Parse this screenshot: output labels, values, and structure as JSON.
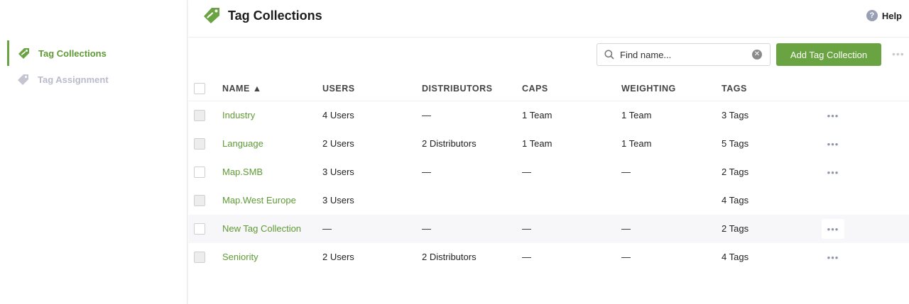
{
  "sidebar": {
    "items": [
      {
        "label": "Tag Collections",
        "icon": "tag-icon",
        "active": true
      },
      {
        "label": "Tag Assignment",
        "icon": "tag-icon",
        "active": false
      }
    ]
  },
  "header": {
    "title": "Tag Collections",
    "help_label": "Help",
    "help_icon": "question-circle-icon"
  },
  "toolbar": {
    "search_placeholder": "Find name...",
    "search_value": "",
    "add_label": "Add Tag Collection",
    "more_label": "•••"
  },
  "colors": {
    "accent": "#6aa342",
    "link": "#5f9a35",
    "muted": "#b9bcc9"
  },
  "table": {
    "columns": [
      "NAME ▲",
      "USERS",
      "DISTRIBUTORS",
      "CAPS",
      "WEIGHTING",
      "TAGS"
    ],
    "sort": {
      "column": "NAME",
      "direction": "asc"
    },
    "more_label": "•••",
    "rows": [
      {
        "name": "Industry",
        "users": "4 Users",
        "distributors": "—",
        "caps": "1 Team",
        "weighting": "1 Team",
        "tags": "3 Tags",
        "checkbox": "gray",
        "more": true,
        "hover": false
      },
      {
        "name": "Language",
        "users": "2 Users",
        "distributors": "2 Distributors",
        "caps": "1 Team",
        "weighting": "1 Team",
        "tags": "5 Tags",
        "checkbox": "gray",
        "more": true,
        "hover": false
      },
      {
        "name": "Map.SMB",
        "users": "3 Users",
        "distributors": "—",
        "caps": "—",
        "weighting": "—",
        "tags": "2 Tags",
        "checkbox": "white",
        "more": true,
        "hover": false
      },
      {
        "name": "Map.West Europe",
        "users": "3 Users",
        "distributors": "",
        "caps": "",
        "weighting": "",
        "tags": "4 Tags",
        "checkbox": "gray",
        "more": false,
        "hover": false
      },
      {
        "name": "New Tag Collection",
        "users": "—",
        "distributors": "—",
        "caps": "—",
        "weighting": "—",
        "tags": "2 Tags",
        "checkbox": "white",
        "more": true,
        "hover": true
      },
      {
        "name": "Seniority",
        "users": "2 Users",
        "distributors": "2 Distributors",
        "caps": "—",
        "weighting": "—",
        "tags": "4 Tags",
        "checkbox": "gray",
        "more": true,
        "hover": false
      }
    ]
  }
}
